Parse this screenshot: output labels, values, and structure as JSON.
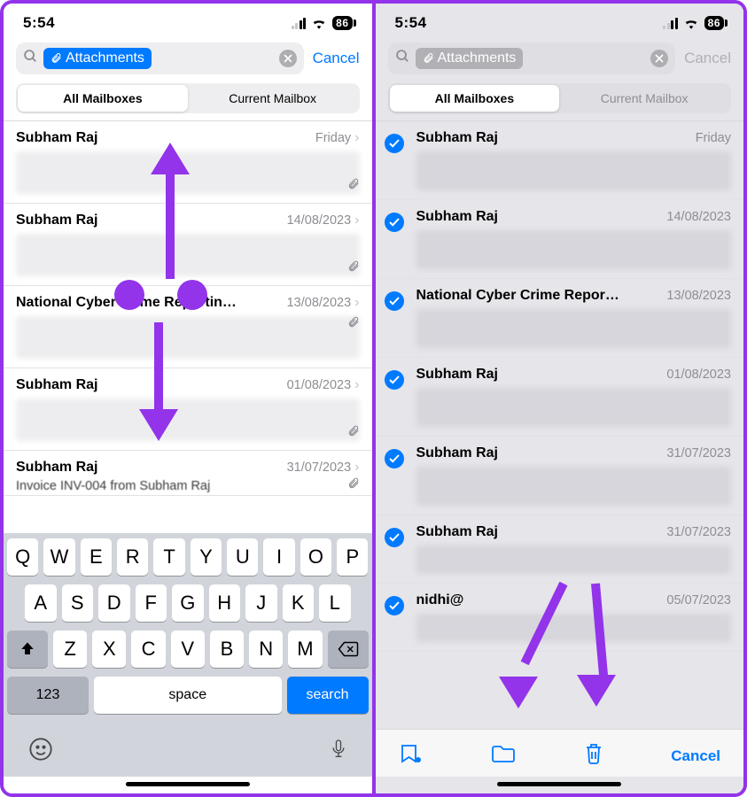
{
  "left": {
    "status": {
      "time": "5:54",
      "battery": "86"
    },
    "search": {
      "token": "Attachments",
      "cancel": "Cancel"
    },
    "segments": {
      "all": "All Mailboxes",
      "current": "Current Mailbox"
    },
    "emails": [
      {
        "sender": "Subham Raj",
        "date": "Friday"
      },
      {
        "sender": "Subham Raj",
        "date": "14/08/2023"
      },
      {
        "sender": "National Cyber Crime Reportin…",
        "date": "13/08/2023"
      },
      {
        "sender": "Subham Raj",
        "date": "01/08/2023"
      },
      {
        "sender": "Subham Raj",
        "date": "31/07/2023",
        "subject": "Invoice INV-004 from Subham Raj"
      }
    ],
    "keyboard": {
      "row1": [
        "Q",
        "W",
        "E",
        "R",
        "T",
        "Y",
        "U",
        "I",
        "O",
        "P"
      ],
      "row2": [
        "A",
        "S",
        "D",
        "F",
        "G",
        "H",
        "J",
        "K",
        "L"
      ],
      "row3": [
        "Z",
        "X",
        "C",
        "V",
        "B",
        "N",
        "M"
      ],
      "num": "123",
      "space": "space",
      "search": "search"
    }
  },
  "right": {
    "status": {
      "time": "5:54",
      "battery": "86"
    },
    "search": {
      "token": "Attachments",
      "cancel": "Cancel"
    },
    "segments": {
      "all": "All Mailboxes",
      "current": "Current Mailbox"
    },
    "emails": [
      {
        "sender": "Subham Raj",
        "date": "Friday"
      },
      {
        "sender": "Subham Raj",
        "date": "14/08/2023"
      },
      {
        "sender": "National Cyber Crime Repor…",
        "date": "13/08/2023"
      },
      {
        "sender": "Subham Raj",
        "date": "01/08/2023"
      },
      {
        "sender": "Subham Raj",
        "date": "31/07/2023"
      },
      {
        "sender": "Subham Raj",
        "date": "31/07/2023"
      },
      {
        "sender": "nidhi@",
        "date": "05/07/2023"
      }
    ],
    "toolbar": {
      "cancel": "Cancel"
    }
  }
}
